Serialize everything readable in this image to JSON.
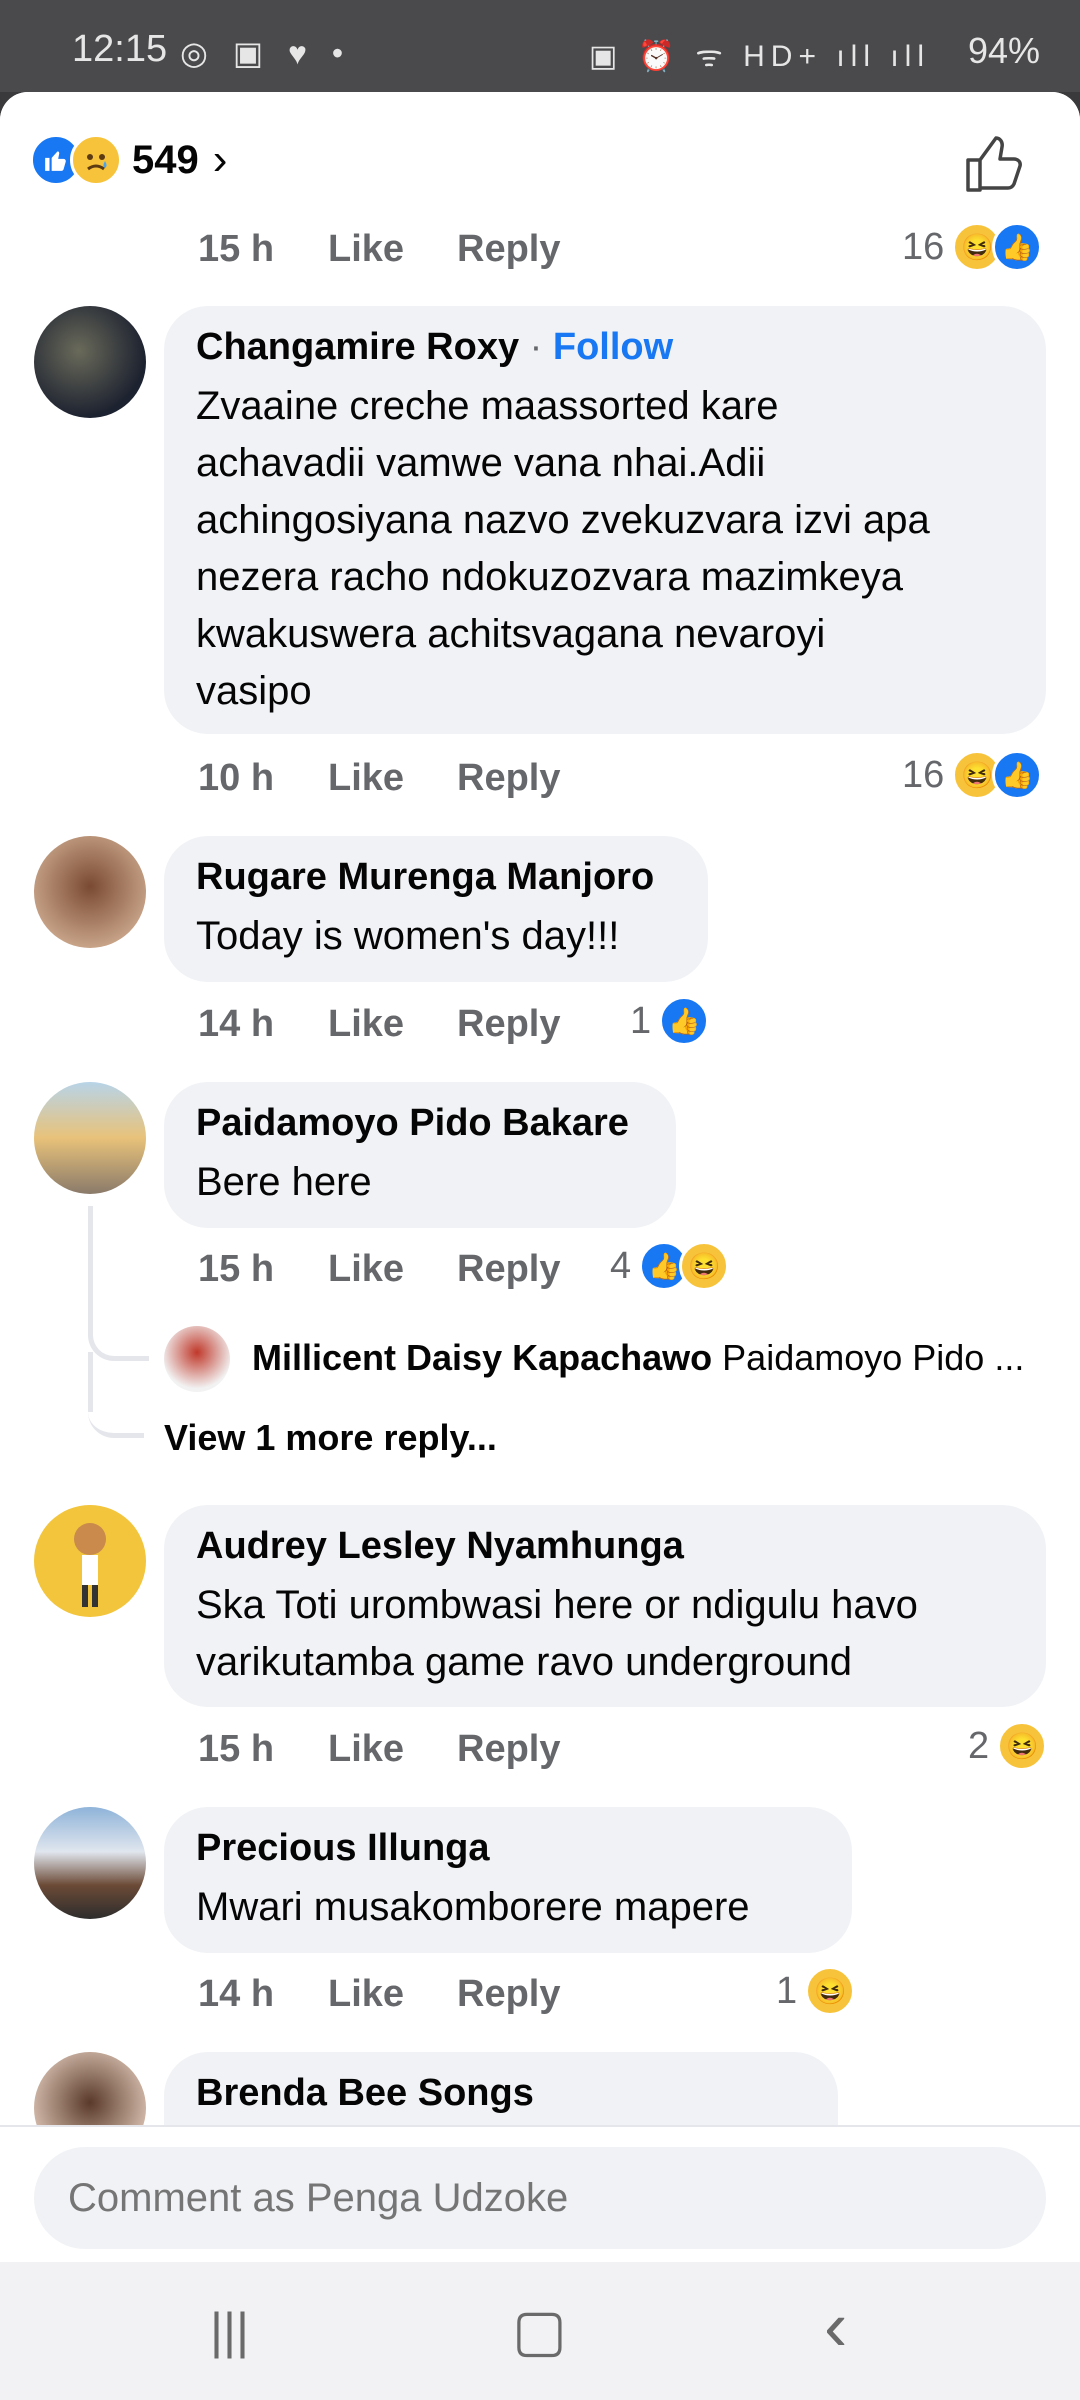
{
  "status_bar": {
    "time": "12:15",
    "left_icons": "◎ ▣ ♥ •",
    "right_icons": "▣ ⏰ ᯤ HD+ ıll ıll",
    "battery": "94%"
  },
  "header": {
    "reaction_count": "549",
    "emojis": [
      "like",
      "sad"
    ]
  },
  "colors": {
    "accent": "#1877f2",
    "bubble": "#f0f2f5",
    "meta": "#65676b"
  },
  "comments": [
    {
      "time": "15 h",
      "like": "Like",
      "reply": "Reply",
      "reactions": "16"
    },
    {
      "author": "Changamire Roxy",
      "dot": "·",
      "follow": "Follow",
      "lines": [
        "Zvaaine creche maassorted kare",
        "achavadii vamwe vana nhai.Adii",
        "achingosiyana nazvo zvekuzvara izvi apa",
        "nezera racho ndokuzozvara mazimkeya",
        "kwakuswera achitsvagana nevaroyi",
        "vasipo"
      ],
      "time": "10 h",
      "like": "Like",
      "reply": "Reply",
      "reactions": "16"
    },
    {
      "author": "Rugare Murenga Manjoro",
      "text": "Today is women's day!!!",
      "time": "14 h",
      "like": "Like",
      "reply": "Reply",
      "reactions": "1"
    },
    {
      "author": "Paidamoyo Pido Bakare",
      "text": "Bere here",
      "time": "15 h",
      "like": "Like",
      "reply": "Reply",
      "reactions": "4",
      "reply_preview": {
        "author": "Millicent Daisy Kapachawo",
        "snippet": "Paidamoyo Pido ..."
      },
      "more_replies": "View 1 more reply..."
    },
    {
      "author": "Audrey Lesley Nyamhunga",
      "lines": [
        "Ska Toti urombwasi here or ndigulu havo",
        "varikutamba game ravo underground"
      ],
      "time": "15 h",
      "like": "Like",
      "reply": "Reply",
      "reactions": "2"
    },
    {
      "author": "Precious Illunga",
      "text": "Mwari musakomborere mapere",
      "time": "14 h",
      "like": "Like",
      "reply": "Reply",
      "reactions": "1"
    },
    {
      "author": "Brenda Bee Songs"
    }
  ],
  "composer": {
    "placeholder": "Comment as Penga Udzoke"
  },
  "nav": {
    "recent": "|||",
    "home": "▢",
    "back": "‹"
  }
}
